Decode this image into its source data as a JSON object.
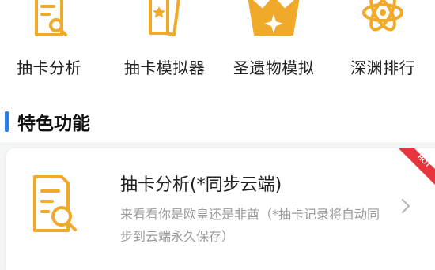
{
  "tools": [
    {
      "label": "抽卡分析",
      "icon": "document-search-icon"
    },
    {
      "label": "抽卡模拟器",
      "icon": "card-star-icon"
    },
    {
      "label": "圣遗物模拟",
      "icon": "crown-icon"
    },
    {
      "label": "深渊排行",
      "icon": "atom-icon"
    }
  ],
  "section": {
    "title": "特色功能"
  },
  "feature_card": {
    "title": "抽卡分析(*同步云端)",
    "description": "来看看你是欧皇还是非酋（*抽卡记录将自动同步到云端永久保存）",
    "badge": "HOT",
    "icon": "document-search-icon"
  },
  "colors": {
    "accent": "#2f7be0",
    "icon_gold": "#f0a928",
    "badge_red": "#e8343c"
  }
}
